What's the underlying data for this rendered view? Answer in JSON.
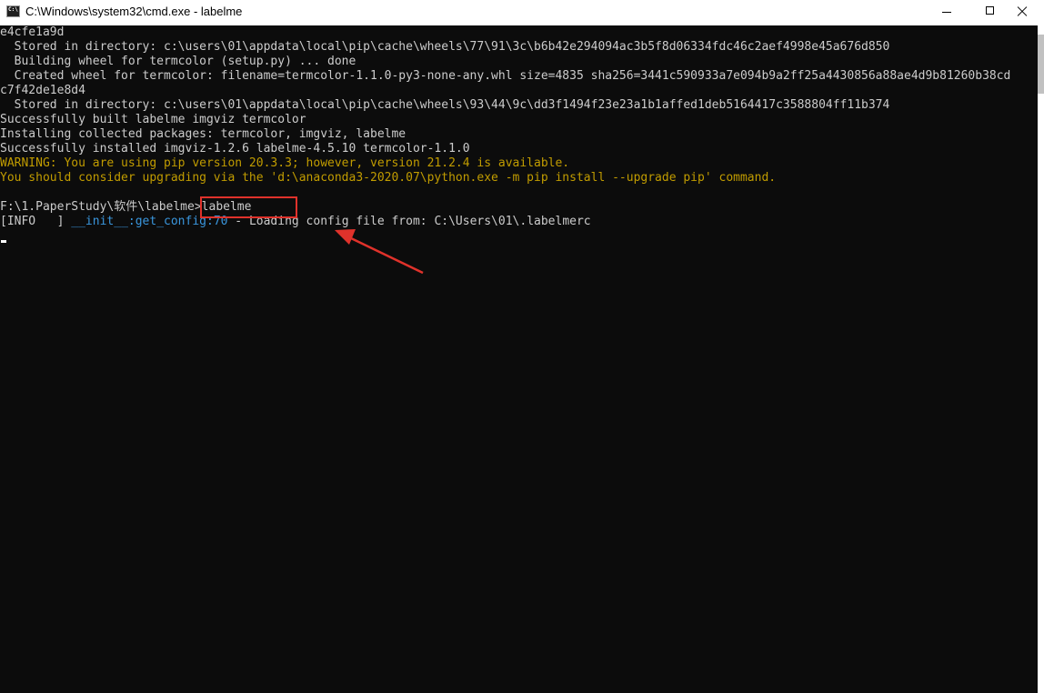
{
  "window": {
    "icon_text": "C:\\",
    "title": "C:\\Windows\\system32\\cmd.exe - labelme"
  },
  "console": {
    "lines": [
      "e4cfe1a9d",
      "  Stored in directory: c:\\users\\01\\appdata\\local\\pip\\cache\\wheels\\77\\91\\3c\\b6b42e294094ac3b5f8d06334fdc46c2aef4998e45a676d850",
      "  Building wheel for termcolor (setup.py) ... done",
      "  Created wheel for termcolor: filename=termcolor-1.1.0-py3-none-any.whl size=4835 sha256=3441c590933a7e094b9a2ff25a4430856a88ae4d9b81260b38cd",
      "c7f42de1e8d4",
      "  Stored in directory: c:\\users\\01\\appdata\\local\\pip\\cache\\wheels\\93\\44\\9c\\dd3f1494f23e23a1b1affed1deb5164417c3588804ff11b374",
      "Successfully built labelme imgviz termcolor",
      "Installing collected packages: termcolor, imgviz, labelme",
      "Successfully installed imgviz-1.2.6 labelme-4.5.10 termcolor-1.1.0"
    ],
    "warning_lines": [
      "WARNING: You are using pip version 20.3.3; however, version 21.2.4 is available.",
      "You should consider upgrading via the 'd:\\anaconda3-2020.07\\python.exe -m pip install --upgrade pip' command."
    ],
    "prompt": "F:\\1.PaperStudy\\软件\\labelme>",
    "command": "labelme",
    "info_prefix": "[INFO   ] ",
    "info_module": "__init__:get_config:70",
    "info_message": " - Loading config file from: C:\\Users\\01\\.labelmerc"
  },
  "colors": {
    "background": "#0c0c0c",
    "text": "#cccccc",
    "warning": "#c19c00",
    "info_module": "#3a96dd",
    "annotation": "#e0322b"
  }
}
